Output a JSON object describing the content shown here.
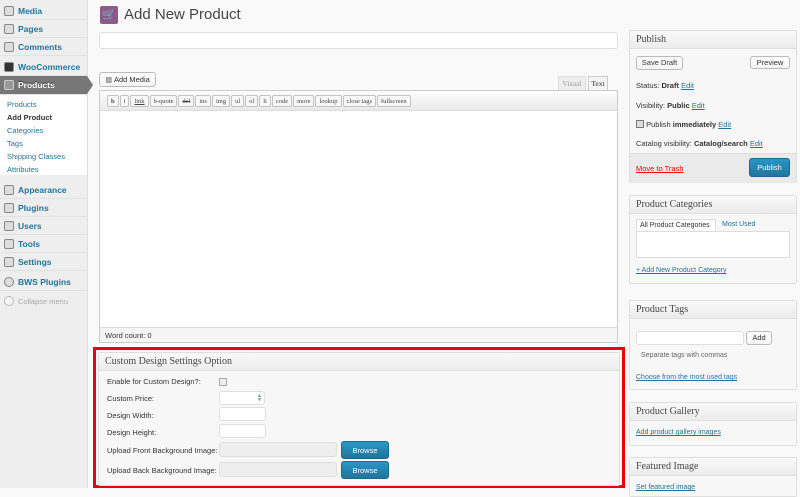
{
  "sidebar": {
    "items": [
      "Media",
      "Pages",
      "Comments",
      "WooCommerce",
      "Products",
      "Appearance",
      "Plugins",
      "Users",
      "Tools",
      "Settings",
      "BWS Plugins"
    ],
    "submenu": [
      "Products",
      "Add Product",
      "Categories",
      "Tags",
      "Shipping Classes",
      "Attributes"
    ],
    "collapse": "Collapse menu"
  },
  "page": {
    "title": "Add New Product",
    "title_value": ""
  },
  "editor": {
    "add_media": "Add Media",
    "tab_visual": "Visual",
    "tab_text": "Text",
    "quicktags": [
      "b",
      "i",
      "link",
      "b-quote",
      "del",
      "ins",
      "img",
      "ul",
      "ol",
      "li",
      "code",
      "more",
      "lookup",
      "close tags",
      "fullscreen"
    ],
    "content": "",
    "word_count": "Word count: 0"
  },
  "custom": {
    "title": "Custom Design Settings Option",
    "enable": "Enable for Custom Design?:",
    "price": "Custom Price:",
    "width": "Design Width:",
    "height": "Design Height:",
    "front": "Upload Front Background Image:",
    "back": "Upload Back Background Image:",
    "browse": "Browse"
  },
  "publish": {
    "title": "Publish",
    "save_draft": "Save Draft",
    "preview": "Preview",
    "status_label": "Status:",
    "status": "Draft",
    "visibility_label": "Visibility:",
    "visibility": "Public",
    "publish_label": "Publish",
    "publish_when": "immediately",
    "catalog_label": "Catalog visibility:",
    "catalog": "Catalog/search",
    "edit": "Edit",
    "trash": "Move to Trash",
    "publish_btn": "Publish"
  },
  "categories": {
    "title": "Product Categories",
    "tab_all": "All Product Categories",
    "tab_used": "Most Used",
    "add": "+ Add New Product Category"
  },
  "tags": {
    "title": "Product Tags",
    "add": "Add",
    "hint": "Separate tags with commas",
    "choose": "Choose from the most used tags"
  },
  "gallery": {
    "title": "Product Gallery",
    "add": "Add product gallery images"
  },
  "featured": {
    "title": "Featured Image",
    "set": "Set featured image"
  }
}
